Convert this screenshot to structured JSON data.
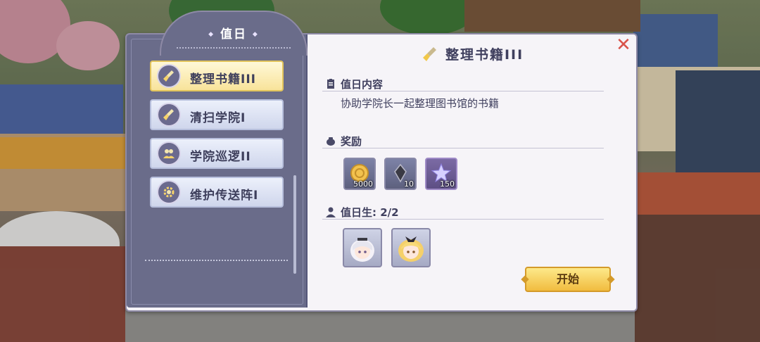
{
  "panel_title": "值日",
  "tasks": [
    {
      "label": "整理书籍III",
      "icon": "broom-icon"
    },
    {
      "label": "清扫学院I",
      "icon": "broom-icon"
    },
    {
      "label": "学院巡逻II",
      "icon": "people-icon"
    },
    {
      "label": "维护传送阵I",
      "icon": "gear-icon"
    }
  ],
  "selected_task": "整理书籍III",
  "content_title": "整理书籍III",
  "content_section": {
    "heading": "值日内容",
    "text": "协助学院长一起整理图书馆的书籍"
  },
  "reward_section": {
    "heading": "奖励",
    "items": [
      {
        "name": "gold-coin",
        "qty": "5000"
      },
      {
        "name": "dark-crystal",
        "qty": "10"
      },
      {
        "name": "exp-star",
        "qty": "150"
      }
    ]
  },
  "members_section": {
    "heading": "值日生:",
    "count": "2/2",
    "members": [
      "white-haired-girl-avatar",
      "blonde-girl-avatar"
    ]
  },
  "start_button": "开始",
  "colors": {
    "accent": "#f1bc3f",
    "panel": "#6a6c8a",
    "close": "#d9534a"
  }
}
